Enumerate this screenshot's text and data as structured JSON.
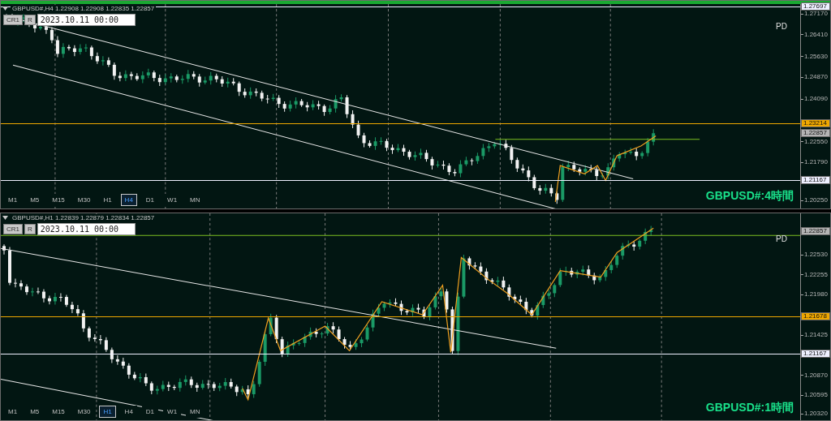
{
  "panels": [
    {
      "header": "GBPUSD#,H4 1.22908 1.22908 1.22835 1.22857",
      "buttons": [
        "CR1",
        "R"
      ],
      "date": "2023.10.11 00:00",
      "label": "PD",
      "title": "GBPUSD#:4時間",
      "timeframes": [
        {
          "label": "M1",
          "selected": false
        },
        {
          "label": "M5",
          "selected": false
        },
        {
          "label": "M15",
          "selected": false
        },
        {
          "label": "M30",
          "selected": false
        },
        {
          "label": "H1",
          "selected": false
        },
        {
          "label": "H4",
          "selected": true
        },
        {
          "label": "D1",
          "selected": false
        },
        {
          "label": "W1",
          "selected": false
        },
        {
          "label": "MN",
          "selected": false
        }
      ],
      "axis_ticks": [
        "1.27170",
        "1.26410",
        "1.25630",
        "1.24870",
        "1.24090",
        "1.22550",
        "1.21790",
        "1.20250"
      ],
      "price_markers": [
        {
          "price": "1.27697",
          "color": "#eef0ff",
          "line": true
        },
        {
          "price": "1.23214",
          "color": "#f0a800",
          "line": true
        },
        {
          "price": "1.22857",
          "color": "#b4b4b4",
          "line": false
        },
        {
          "price": "1.21167",
          "color": "#eef0ff",
          "line": true
        }
      ]
    },
    {
      "header": "GBPUSD#,H1 1.22839 1.22879 1.22834 1.22857",
      "buttons": [
        "CR1",
        "R"
      ],
      "date": "2023.10.11 00:00",
      "label": "PD",
      "title": "GBPUSD#:1時間",
      "timeframes": [
        {
          "label": "M1",
          "selected": false
        },
        {
          "label": "M5",
          "selected": false
        },
        {
          "label": "M15",
          "selected": false
        },
        {
          "label": "M30",
          "selected": false
        },
        {
          "label": "H1",
          "selected": true
        },
        {
          "label": "H4",
          "selected": false
        },
        {
          "label": "D1",
          "selected": false
        },
        {
          "label": "W1",
          "selected": false
        },
        {
          "label": "MN",
          "selected": false
        }
      ],
      "axis_ticks": [
        "1.22530",
        "1.22255",
        "1.21980",
        "1.21425",
        "1.20870",
        "1.20595",
        "1.20320"
      ],
      "price_markers": [
        {
          "price": "1.22857",
          "color": "#b4b4b4",
          "line": false
        },
        {
          "price": "1.21678",
          "color": "#f0a800",
          "line": true
        },
        {
          "price": "1.21167",
          "color": "#eef0ff",
          "line": true
        }
      ]
    }
  ]
}
